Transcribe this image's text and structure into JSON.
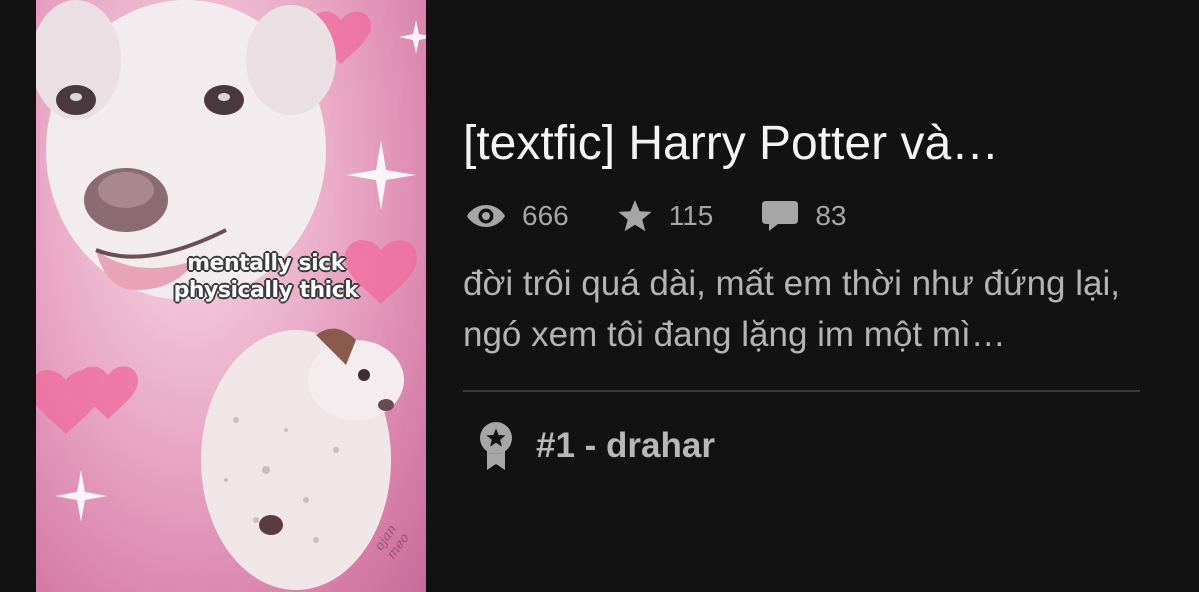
{
  "story": {
    "title": "[textfic] Harry Potter và…",
    "description": "đời trôi quá dài, mất em thời như đứng lại, ngó xem tôi đang lặng im một mì…",
    "stats": {
      "views": "666",
      "votes": "115",
      "comments": "83"
    },
    "rank": {
      "label": "#1 - drahar"
    },
    "cover": {
      "caption_line1": "mentally sick",
      "caption_line2": "physically thick",
      "watermark": "ojan meo"
    }
  },
  "icons": {
    "views": "eye-icon",
    "votes": "star-icon",
    "comments": "comment-icon",
    "rank": "ribbon-badge-icon"
  },
  "colors": {
    "background": "#121212",
    "title": "#f4f4f4",
    "secondary_text": "#a6a6a6",
    "divider": "#3a3a3a"
  }
}
